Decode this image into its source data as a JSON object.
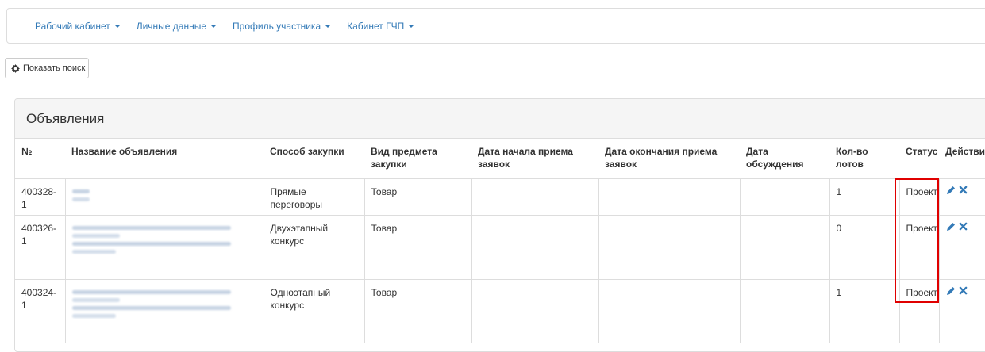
{
  "nav": {
    "items": [
      {
        "label": "Рабочий кабинет"
      },
      {
        "label": "Личные данные"
      },
      {
        "label": "Профиль участника"
      },
      {
        "label": "Кабинет ГЧП"
      }
    ]
  },
  "search_button": {
    "label": "Показать поиск"
  },
  "panel": {
    "title": "Объявления"
  },
  "table": {
    "headers": [
      "№",
      "Название объявления",
      "Способ закупки",
      "Вид предмета закупки",
      "Дата начала приема заявок",
      "Дата окончания приема заявок",
      "Дата обсуждения",
      "Кол-во лотов",
      "Статус",
      "Действия"
    ],
    "rows": [
      {
        "number": "400328-1",
        "method": "Прямые переговоры",
        "subject": "Товар",
        "start": "",
        "end": "",
        "discussion": "",
        "lots": "1",
        "status": "Проект"
      },
      {
        "number": "400326-1",
        "method": "Двухэтапный конкурс",
        "subject": "Товар",
        "start": "",
        "end": "",
        "discussion": "",
        "lots": "0",
        "status": "Проект"
      },
      {
        "number": "400324-1",
        "method": "Одноэтапный конкурс",
        "subject": "Товар",
        "start": "",
        "end": "",
        "discussion": "",
        "lots": "1",
        "status": "Проект"
      }
    ]
  },
  "colors": {
    "link": "#337ab7",
    "highlight": "#e00000",
    "border": "#dddddd"
  }
}
